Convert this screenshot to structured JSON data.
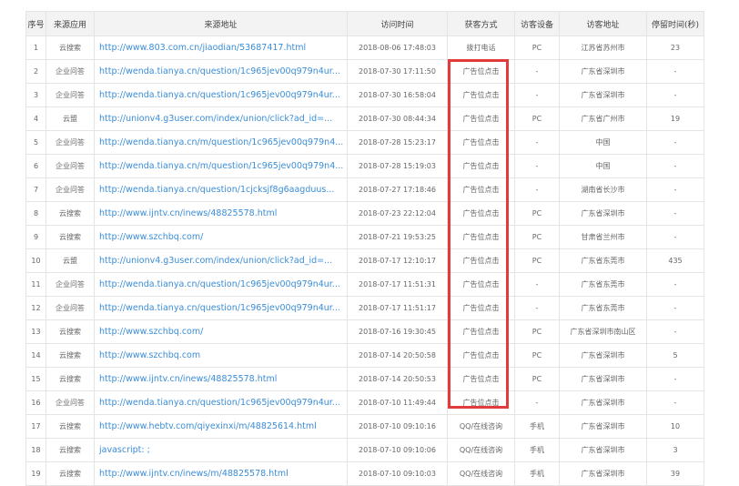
{
  "headers": [
    "序号",
    "来源应用",
    "来源地址",
    "访问时间",
    "获客方式",
    "访客设备",
    "访客地址",
    "停留时间(秒)"
  ],
  "rows": [
    {
      "no": "1",
      "app": "云搜索",
      "url": "http://www.803.com.cn/jiaodian/53687417.html",
      "time": "2018-08-06 17:48:03",
      "method": "拨打电话",
      "device": "PC",
      "addr": "江苏省苏州市",
      "stay": "23"
    },
    {
      "no": "2",
      "app": "企业问答",
      "url": "http://wenda.tianya.cn/question/1c965jev00q979n4ur...",
      "time": "2018-07-30 17:11:50",
      "method": "广告位点击",
      "device": "-",
      "addr": "广东省深圳市",
      "stay": "-"
    },
    {
      "no": "3",
      "app": "企业问答",
      "url": "http://wenda.tianya.cn/question/1c965jev00q979n4ur...",
      "time": "2018-07-30 16:58:04",
      "method": "广告位点击",
      "device": "-",
      "addr": "广东省深圳市",
      "stay": "-"
    },
    {
      "no": "4",
      "app": "云盟",
      "url": "http://unionv4.g3user.com/index/union/click?ad_id=...",
      "time": "2018-07-30 08:44:34",
      "method": "广告位点击",
      "device": "PC",
      "addr": "广东省广州市",
      "stay": "19"
    },
    {
      "no": "5",
      "app": "企业问答",
      "url": "http://wenda.tianya.cn/m/question/1c965jev00q979n4...",
      "time": "2018-07-28 15:23:17",
      "method": "广告位点击",
      "device": "-",
      "addr": "中国",
      "stay": "-"
    },
    {
      "no": "6",
      "app": "企业问答",
      "url": "http://wenda.tianya.cn/m/question/1c965jev00q979n4...",
      "time": "2018-07-28 15:19:03",
      "method": "广告位点击",
      "device": "-",
      "addr": "中国",
      "stay": "-"
    },
    {
      "no": "7",
      "app": "企业问答",
      "url": "http://wenda.tianya.cn/question/1cjcksjf8g6aagduus...",
      "time": "2018-07-27 17:18:46",
      "method": "广告位点击",
      "device": "-",
      "addr": "湖南省长沙市",
      "stay": "-"
    },
    {
      "no": "8",
      "app": "云搜索",
      "url": "http://www.ijntv.cn/inews/48825578.html",
      "time": "2018-07-23 22:12:04",
      "method": "广告位点击",
      "device": "PC",
      "addr": "广东省深圳市",
      "stay": "-"
    },
    {
      "no": "9",
      "app": "云搜索",
      "url": "http://www.szchbq.com/",
      "time": "2018-07-21 19:53:25",
      "method": "广告位点击",
      "device": "PC",
      "addr": "甘肃省兰州市",
      "stay": "-"
    },
    {
      "no": "10",
      "app": "云盟",
      "url": "http://unionv4.g3user.com/index/union/click?ad_id=...",
      "time": "2018-07-17 12:10:17",
      "method": "广告位点击",
      "device": "PC",
      "addr": "广东省东莞市",
      "stay": "435"
    },
    {
      "no": "11",
      "app": "企业问答",
      "url": "http://wenda.tianya.cn/question/1c965jev00q979n4ur...",
      "time": "2018-07-17 11:51:31",
      "method": "广告位点击",
      "device": "-",
      "addr": "广东省东莞市",
      "stay": "-"
    },
    {
      "no": "12",
      "app": "企业问答",
      "url": "http://wenda.tianya.cn/question/1c965jev00q979n4ur...",
      "time": "2018-07-17 11:51:17",
      "method": "广告位点击",
      "device": "-",
      "addr": "广东省东莞市",
      "stay": "-"
    },
    {
      "no": "13",
      "app": "云搜索",
      "url": "http://www.szchbq.com/",
      "time": "2018-07-16 19:30:45",
      "method": "广告位点击",
      "device": "PC",
      "addr": "广东省深圳市南山区",
      "stay": "-"
    },
    {
      "no": "14",
      "app": "云搜索",
      "url": "http://www.szchbq.com",
      "time": "2018-07-14 20:50:58",
      "method": "广告位点击",
      "device": "PC",
      "addr": "广东省深圳市",
      "stay": "5"
    },
    {
      "no": "15",
      "app": "云搜索",
      "url": "http://www.ijntv.cn/inews/48825578.html",
      "time": "2018-07-14 20:50:53",
      "method": "广告位点击",
      "device": "PC",
      "addr": "广东省深圳市",
      "stay": "-"
    },
    {
      "no": "16",
      "app": "企业问答",
      "url": "http://wenda.tianya.cn/question/1c965jev00q979n4ur...",
      "time": "2018-07-10 11:49:44",
      "method": "广告位点击",
      "device": "-",
      "addr": "广东省深圳市",
      "stay": "-"
    },
    {
      "no": "17",
      "app": "云搜索",
      "url": "http://www.hebtv.com/qiyexinxi/m/48825614.html",
      "time": "2018-07-10 09:10:16",
      "method": "QQ/在线咨询",
      "device": "手机",
      "addr": "广东省深圳市",
      "stay": "10"
    },
    {
      "no": "18",
      "app": "云搜索",
      "url": "javascript: ;",
      "time": "2018-07-10 09:10:06",
      "method": "QQ/在线咨询",
      "device": "手机",
      "addr": "广东省深圳市",
      "stay": "3"
    },
    {
      "no": "19",
      "app": "云搜索",
      "url": "http://www.ijntv.cn/inews/m/48825578.html",
      "time": "2018-07-10 09:10:03",
      "method": "QQ/在线咨询",
      "device": "手机",
      "addr": "广东省深圳市",
      "stay": "39"
    }
  ],
  "accent": "#e23b3b",
  "link_color": "#3a8dd8"
}
